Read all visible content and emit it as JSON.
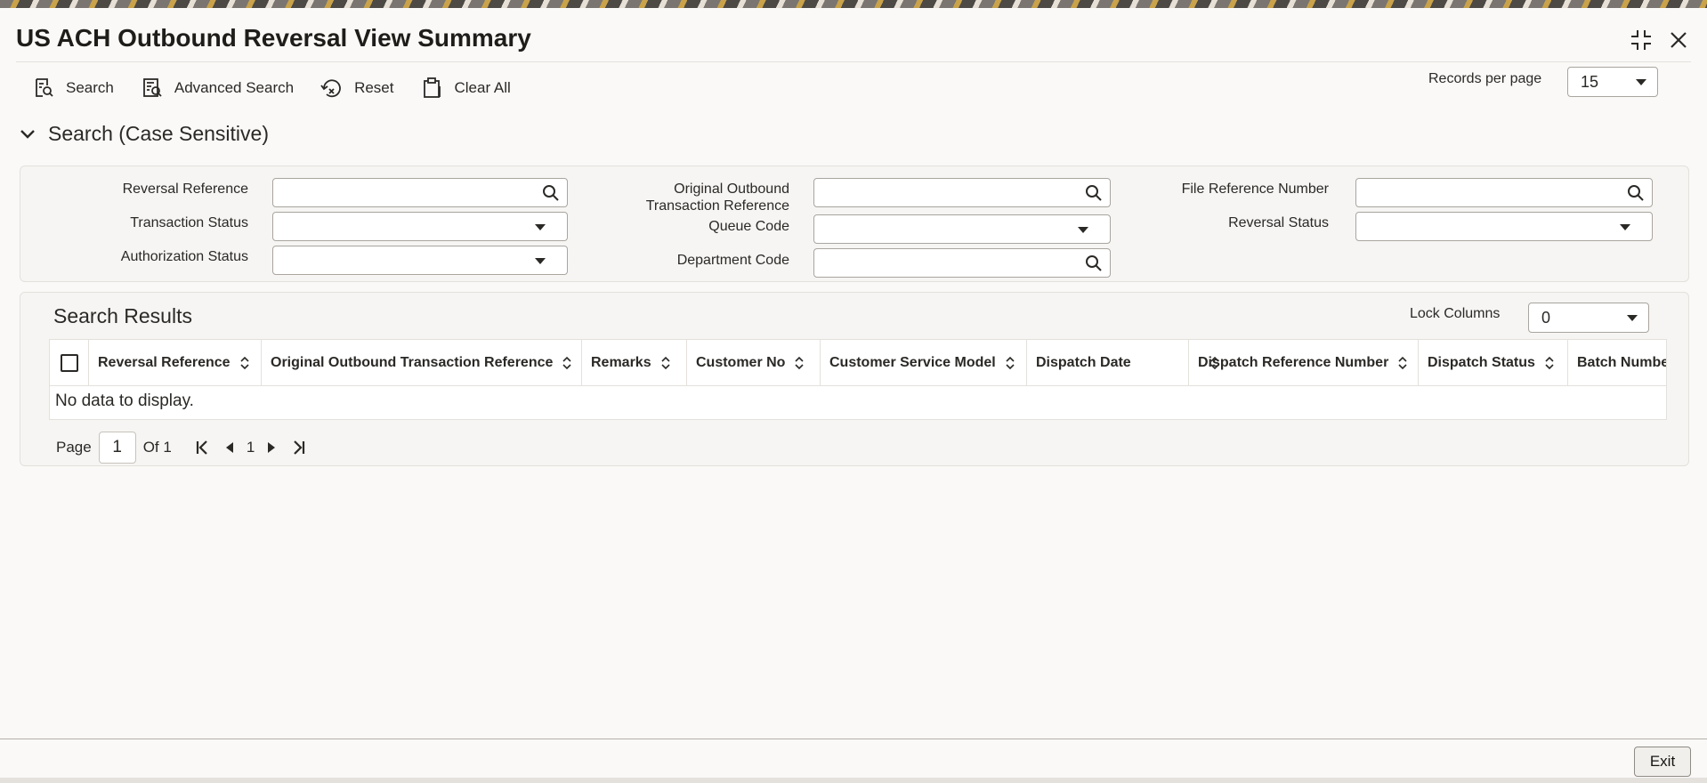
{
  "window": {
    "title": "US ACH Outbound Reversal View Summary",
    "controls": [
      {
        "name": "minimize-icon"
      },
      {
        "name": "close-icon"
      }
    ]
  },
  "toolbar": {
    "search_label": "Search",
    "advanced_search_label": "Advanced Search",
    "reset_label": "Reset",
    "clear_all_label": "Clear All",
    "records_per_page_label": "Records per page",
    "records_per_page_value": "15"
  },
  "search_section": {
    "title": "Search (Case Sensitive)",
    "fields": {
      "reversal_reference": {
        "label": "Reversal Reference",
        "value": ""
      },
      "transaction_status": {
        "label": "Transaction Status",
        "value": ""
      },
      "authorization_status": {
        "label": "Authorization Status",
        "value": ""
      },
      "original_outbound_ref": {
        "label_line1": "Original Outbound",
        "label_line2": "Transaction Reference",
        "value": ""
      },
      "queue_code": {
        "label": "Queue Code",
        "value": ""
      },
      "department_code": {
        "label": "Department Code",
        "value": ""
      },
      "file_reference_number": {
        "label": "File Reference Number",
        "value": ""
      },
      "reversal_status": {
        "label": "Reversal Status",
        "value": ""
      }
    }
  },
  "results": {
    "title": "Search Results",
    "lock_columns_label": "Lock Columns",
    "lock_columns_value": "0",
    "columns": [
      "Reversal Reference",
      "Original Outbound Transaction Reference",
      "Remarks",
      "Customer No",
      "Customer Service Model",
      "Dispatch Date",
      "Dispatch Reference Number",
      "Dispatch Status",
      "Batch Number"
    ],
    "rows": [],
    "empty_message": "No data to display."
  },
  "pagination": {
    "page_label": "Page",
    "current_page": "1",
    "of_label": "Of 1",
    "page_number": "1"
  },
  "footer": {
    "exit_label": "Exit"
  }
}
